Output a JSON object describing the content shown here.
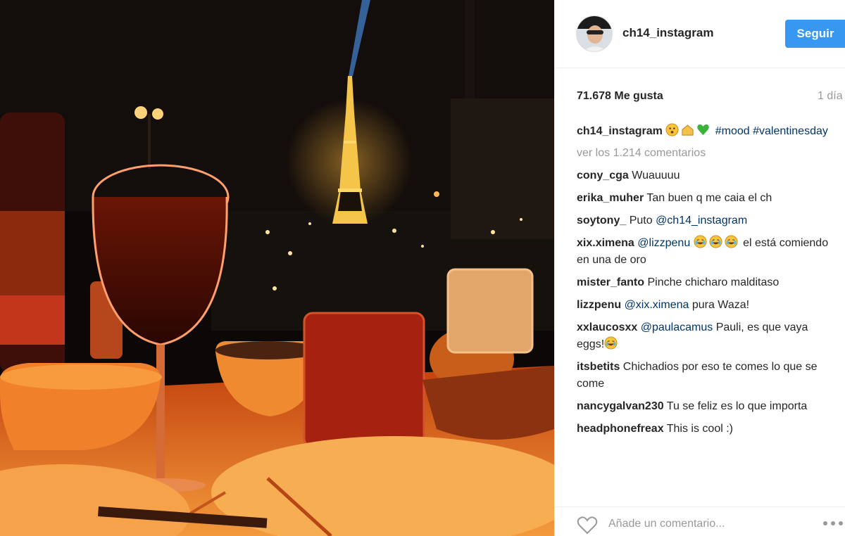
{
  "header": {
    "username": "ch14_instagram",
    "follow_label": "Seguir"
  },
  "stats": {
    "likes": "71.678 Me gusta",
    "time": "1 día"
  },
  "caption": {
    "user": "ch14_instagram",
    "emoji": [
      "face-emoji",
      "house-emoji",
      "green-heart-emoji"
    ],
    "tags": [
      "#mood",
      "#valentinesday"
    ]
  },
  "view_all_comments": "ver los 1.214 comentarios",
  "comments": [
    {
      "user": "cony_cga",
      "text": "Wuauuuu"
    },
    {
      "user": "erika_muher",
      "text": "Tan buen q me caia el ch"
    },
    {
      "user": "soytony_",
      "text": "Puto ",
      "mention": "@ch14_instagram"
    },
    {
      "user": "xix.ximena",
      "mention": "@lizzpenu",
      "text_after": " el está comiendo en una de oro",
      "emoji_count": 3
    },
    {
      "user": "mister_fanto",
      "text": "Pinche chicharo malditaso"
    },
    {
      "user": "lizzpenu",
      "mention": "@xix.ximena",
      "text_after": " pura Waza!"
    },
    {
      "user": "xxlaucosxx",
      "mention": "@paulacamus",
      "text_after": " Pauli, es que vaya eggs!"
    },
    {
      "user": "itsbetits",
      "text": "Chichadios por eso te comes lo que se come"
    },
    {
      "user": "nancygalvan230",
      "text": "Tu se feliz es lo que importa"
    },
    {
      "user": "headphonefreax",
      "text": "This is cool :)"
    }
  ],
  "footer": {
    "comment_placeholder": "Añade un comentario..."
  },
  "colors": {
    "accent": "#3897f0",
    "link": "#003569",
    "muted": "#999999",
    "text": "#262626"
  }
}
